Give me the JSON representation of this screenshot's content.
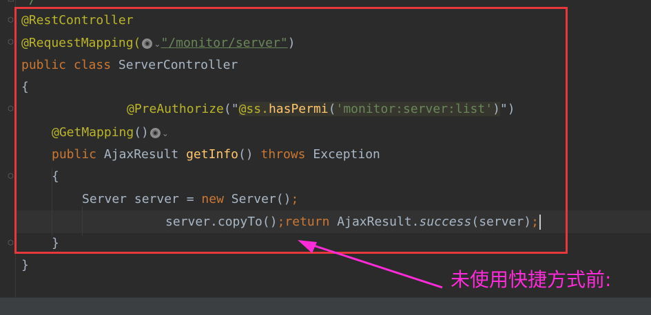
{
  "editor": {
    "top_fragment": "*/",
    "code": {
      "rest_controller": "@RestController",
      "request_mapping": "@RequestMapping(",
      "request_mapping_path": "\"/monitor/server\"",
      "request_mapping_close": ")",
      "public_1": "public",
      "class_kw": "class",
      "class_name": "ServerController",
      "brace_open_class": "{",
      "pre_authorize": "@PreAuthorize",
      "pre_authorize_open": "(\"",
      "spel_ss": "@ss.",
      "spel_method": "hasPermi",
      "spel_open": "(",
      "spel_arg": "'monitor:server:list'",
      "spel_close": ")",
      "pre_authorize_close": "\")",
      "get_mapping": "@GetMapping",
      "get_mapping_parens": "()",
      "public_2": "public",
      "return_type": "AjaxResult",
      "method_name": "getInfo",
      "method_parens": "()",
      "throws_kw": "throws",
      "exception": "Exception",
      "brace_open_method": "{",
      "server_decl": "Server server = ",
      "new_kw": "new",
      "server_ctor": "Server()",
      "semicolon_1": ";",
      "copy_call": "server.copyTo()",
      "semicolon_2": ";",
      "return_kw": "return",
      "ajax_result": "AjaxResult.",
      "success": "success",
      "success_args": "(server)",
      "semicolon_3": ";",
      "brace_close_method": "}",
      "brace_close_class": "}"
    }
  },
  "annotation": {
    "label": "未使用快捷方式前:",
    "color": "#ff2bd8",
    "box_color": "#e8383d"
  },
  "icons": {
    "inlay": "globe-icon",
    "inlay_chevron": "chevron-down-icon",
    "fold": "fold-marker-icon"
  }
}
